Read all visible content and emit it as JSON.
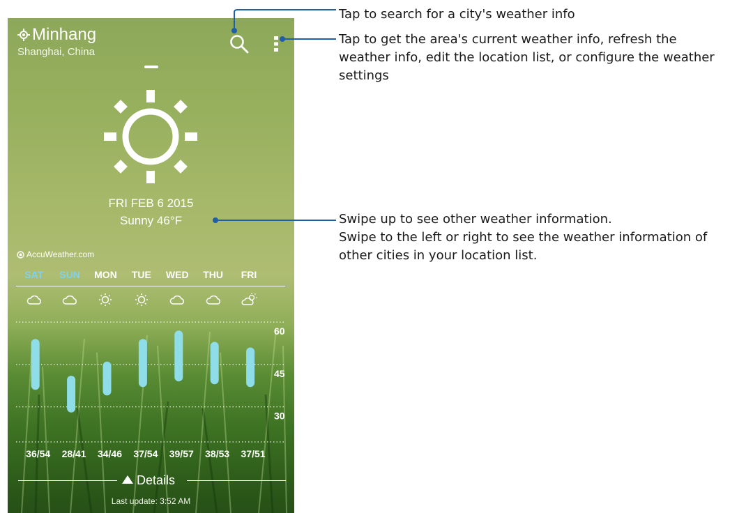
{
  "location": {
    "city": "Minhang",
    "region": "Shanghai, China"
  },
  "current": {
    "date": "FRI FEB 6 2015",
    "condition": "Sunny 46°F",
    "icon": "sun-icon"
  },
  "provider": "AccuWeather.com",
  "forecast": {
    "days": [
      {
        "label": "SAT",
        "icon": "cloud-icon",
        "range": "36/54",
        "low": 36,
        "high": 54,
        "color": "#7fd3ee"
      },
      {
        "label": "SUN",
        "icon": "cloud-icon",
        "range": "28/41",
        "low": 28,
        "high": 41,
        "color": "#7fd3ee"
      },
      {
        "label": "MON",
        "icon": "sun-small-icon",
        "range": "34/46",
        "low": 34,
        "high": 46,
        "color": "#ffffff"
      },
      {
        "label": "TUE",
        "icon": "sun-small-icon",
        "range": "37/54",
        "low": 37,
        "high": 54,
        "color": "#ffffff"
      },
      {
        "label": "WED",
        "icon": "cloud-icon",
        "range": "39/57",
        "low": 39,
        "high": 57,
        "color": "#ffffff"
      },
      {
        "label": "THU",
        "icon": "cloud-icon",
        "range": "38/53",
        "low": 38,
        "high": 53,
        "color": "#ffffff"
      },
      {
        "label": "FRI",
        "icon": "partly-sunny-icon",
        "range": "37/51",
        "low": 37,
        "high": 51,
        "color": "#ffffff"
      }
    ],
    "axis_ticks": [
      "60",
      "45",
      "30"
    ]
  },
  "details_label": "Details",
  "last_update": "Last update: 3:52 AM",
  "annotations": {
    "search": "Tap to search for a city's weather info",
    "menu": "Tap to get the area's current weather info, refresh the weather info, edit the location list, or configure the weather settings",
    "swipe_line1": "Swipe up to see other weather information.",
    "swipe_line2": "Swipe to the left or right to see the weather information of other cities in your location list."
  },
  "colors": {
    "bar": "#8fdde8",
    "weekend_label": "#7fd3ee",
    "leader": "#1f5fa8"
  }
}
